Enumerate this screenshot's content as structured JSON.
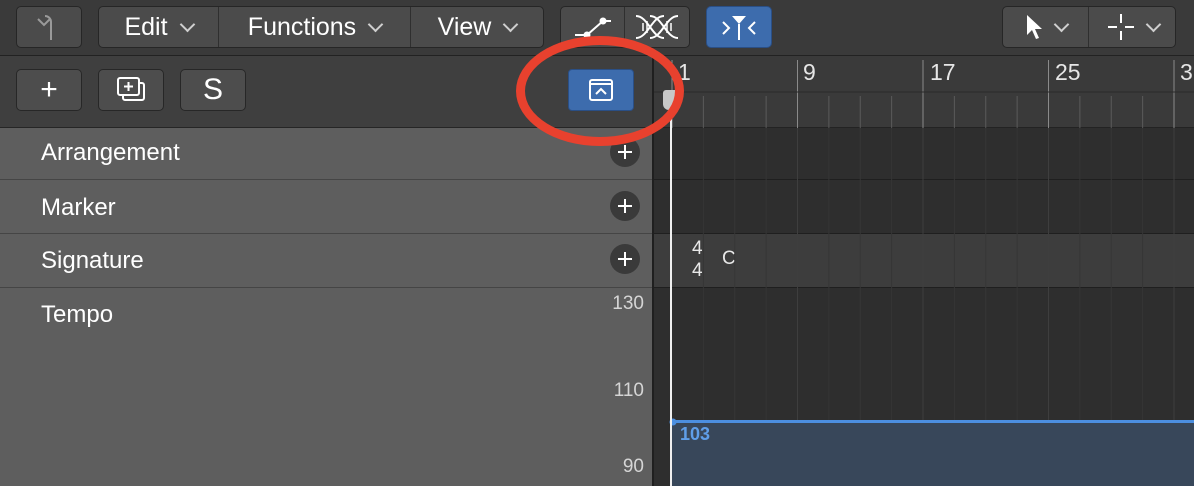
{
  "toolbar": {
    "menus": [
      {
        "label": "Edit"
      },
      {
        "label": "Functions"
      },
      {
        "label": "View"
      }
    ],
    "icons": {
      "back": "back-arrow-icon",
      "automation_curve": "automation-curve-icon",
      "flex": "flex-icon",
      "catch": "catch-playhead-icon",
      "pointer_tool": "pointer-icon",
      "secondary_tool": "crosshair-icon"
    },
    "accent_color": "#3d6cad"
  },
  "left_panel": {
    "buttons": {
      "add": "+",
      "duplicate": "duplicate-track-icon",
      "solo": "S",
      "show_global_tracks": "global-tracks-icon"
    },
    "tracks": [
      {
        "name": "Arrangement"
      },
      {
        "name": "Marker"
      },
      {
        "name": "Signature"
      },
      {
        "name": "Tempo"
      }
    ],
    "tempo_scale": [
      "130",
      "110",
      "90"
    ]
  },
  "ruler": {
    "bars": [
      "1",
      "9",
      "17",
      "25",
      "3"
    ]
  },
  "signature_lane": {
    "time_sig_top": "4",
    "time_sig_bottom": "4",
    "key": "C"
  },
  "tempo_lane": {
    "value": "103",
    "color": "#4c8fe0"
  },
  "annotation": {
    "color": "#e8412e"
  }
}
